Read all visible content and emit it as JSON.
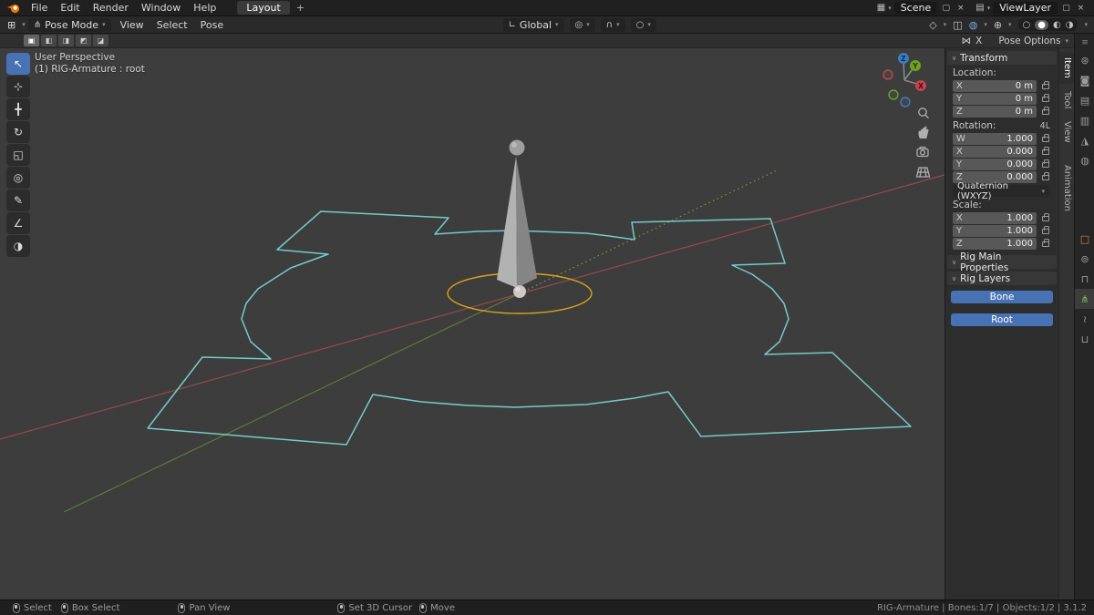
{
  "topbar": {
    "menus": [
      "File",
      "Edit",
      "Render",
      "Window",
      "Help"
    ],
    "workspace_tab": "Layout",
    "add_workspace": "+",
    "scene": {
      "value": "Scene"
    },
    "view_layer": {
      "value": "ViewLayer"
    }
  },
  "header": {
    "mode": "Pose Mode",
    "menus": [
      "View",
      "Select",
      "Pose"
    ],
    "orientation": "Global"
  },
  "tool_settings": {
    "select_modes": [
      "▣",
      "◧",
      "◨",
      "◩",
      "◪"
    ],
    "mirror_label": "X",
    "options_label": "Pose Options"
  },
  "tools": [
    {
      "name": "select-box",
      "glyph": "↖"
    },
    {
      "name": "cursor",
      "glyph": "⊹"
    },
    {
      "name": "move",
      "glyph": "╋"
    },
    {
      "name": "rotate",
      "glyph": "↻"
    },
    {
      "name": "scale",
      "glyph": "◱"
    },
    {
      "name": "transform",
      "glyph": "◎"
    },
    {
      "name": "annotate",
      "glyph": "✎"
    },
    {
      "name": "measure",
      "glyph": "∠"
    },
    {
      "name": "pose-breakdowner",
      "glyph": "◑"
    }
  ],
  "viewport": {
    "view_label": "User Perspective",
    "active_object": "(1) RIG-Armature : root",
    "gizmo": {
      "x": "X",
      "y": "Y",
      "z": "Z"
    }
  },
  "sidebar": {
    "tabs": [
      "Item",
      "Tool",
      "View",
      "Animation"
    ],
    "active_tab": "Item",
    "transform": {
      "title": "Transform",
      "location_label": "Location:",
      "location": [
        [
          "X",
          "0 m"
        ],
        [
          "Y",
          "0 m"
        ],
        [
          "Z",
          "0 m"
        ]
      ],
      "rotation_label": "Rotation:",
      "rotation_badge": "4L",
      "rotation": [
        [
          "W",
          "1.000"
        ],
        [
          "X",
          "0.000"
        ],
        [
          "Y",
          "0.000"
        ],
        [
          "Z",
          "0.000"
        ]
      ],
      "rotation_mode": "Quaternion (WXYZ)",
      "scale_label": "Scale:",
      "scale": [
        [
          "X",
          "1.000"
        ],
        [
          "Y",
          "1.000"
        ],
        [
          "Z",
          "1.000"
        ]
      ]
    },
    "rig_main_properties_title": "Rig Main Properties",
    "rig_layers_title": "Rig Layers",
    "rig_layer_buttons": [
      "Bone",
      "Root"
    ]
  },
  "props_tabs": [
    {
      "name": "tool",
      "glyph": "⊛"
    },
    {
      "name": "render",
      "glyph": "◙"
    },
    {
      "name": "output",
      "glyph": "▤"
    },
    {
      "name": "view-layer",
      "glyph": "▥"
    },
    {
      "name": "scene",
      "glyph": "◮"
    },
    {
      "name": "world",
      "glyph": "◍"
    },
    {
      "name": "object",
      "glyph": "□"
    },
    {
      "name": "physics",
      "glyph": "⊚"
    },
    {
      "name": "constraints",
      "glyph": "⊓"
    },
    {
      "name": "object-data",
      "glyph": "⋔",
      "active": true
    },
    {
      "name": "bone",
      "glyph": "≀"
    },
    {
      "name": "bone-constraints",
      "glyph": "⊔"
    }
  ],
  "statusbar": {
    "hints": [
      "Select",
      "Box Select",
      "Pan View",
      "Set 3D Cursor",
      "Move"
    ],
    "info": "RIG-Armature | Bones:1/7 | Objects:1/2 | 3.1.2"
  },
  "icons": {
    "dropdown": "▾",
    "collapse": "∨",
    "editor_type": "⊞",
    "properties": "≡",
    "mode_pose": "⋔",
    "orientation": "∟",
    "pivot": "◎",
    "snap_magnet": "∩",
    "proportional": "○",
    "visibility": "◇",
    "xray": "◫",
    "overlays": "◍",
    "gizmos": "⊕",
    "shading": [
      "○",
      "●",
      "◐",
      "◑"
    ],
    "mirror": "⋈",
    "scene": "▦",
    "view_layer": "▤",
    "copy": "▢",
    "close": "×"
  },
  "colors": {
    "accent_blue": "#4772b3",
    "bone_wire_cyan": "#79d2d2",
    "bone_circle_orange": "#d9a21a",
    "axis_x_red": "#9e4b52",
    "axis_y_green": "#61803a",
    "object_tab_orange": "#d38a3f",
    "data_tab_green": "#7ac142"
  }
}
